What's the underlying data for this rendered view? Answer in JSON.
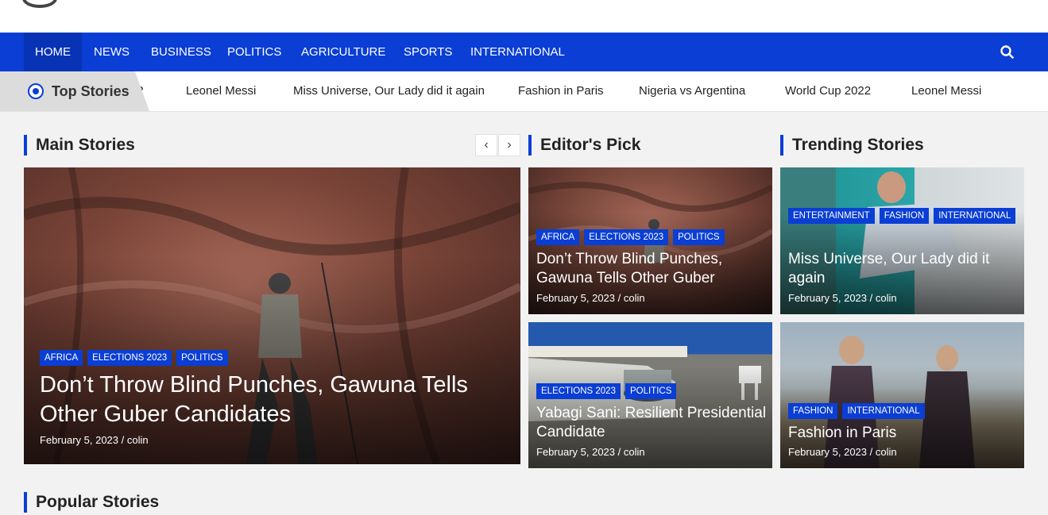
{
  "nav": {
    "items": [
      "HOME",
      "NEWS",
      "BUSINESS",
      "POLITICS",
      "AGRICULTURE",
      "SPORTS",
      "INTERNATIONAL"
    ],
    "active": "HOME"
  },
  "ticker": {
    "label": "Top Stories",
    "partial": "?",
    "items": [
      "Leonel Messi",
      "Miss Universe, Our Lady did it again",
      "Fashion in Paris",
      "Nigeria vs Argentina",
      "World Cup 2022",
      "Leonel Messi"
    ]
  },
  "sections": {
    "main": "Main Stories",
    "editors": "Editor's Pick",
    "trending": "Trending Stories",
    "popular": "Popular Stories"
  },
  "slider": {
    "prev": "‹",
    "next": "›"
  },
  "main_story": {
    "tags": [
      "AFRICA",
      "ELECTIONS 2023",
      "POLITICS"
    ],
    "title": "Don’t Throw Blind Punches, Gawuna Tells Other Guber Candidates",
    "meta": "February 5, 2023 / colin"
  },
  "editors_pick": [
    {
      "tags": [
        "AFRICA",
        "ELECTIONS 2023",
        "POLITICS"
      ],
      "title": "Don’t Throw Blind Punches, Gawuna Tells Other Guber",
      "meta": "February 5, 2023 / colin"
    },
    {
      "tags": [
        "ELECTIONS 2023",
        "POLITICS"
      ],
      "title": "Yabagi Sani: Resilient Presidential Candidate",
      "meta": "February 5, 2023 / colin"
    }
  ],
  "trending": [
    {
      "tags": [
        "ENTERTAINMENT",
        "FASHION",
        "INTERNATIONAL"
      ],
      "title": "Miss Universe, Our Lady did it again",
      "meta": "February 5, 2023 / colin"
    },
    {
      "tags": [
        "FASHION",
        "INTERNATIONAL"
      ],
      "title": "Fashion in Paris",
      "meta": "February 5, 2023 / colin"
    }
  ],
  "colors": {
    "accent": "#0a3ed4",
    "nav_active": "#0833b5"
  },
  "icons": {
    "search": "search-icon",
    "ticker": "radio-dot-icon"
  }
}
